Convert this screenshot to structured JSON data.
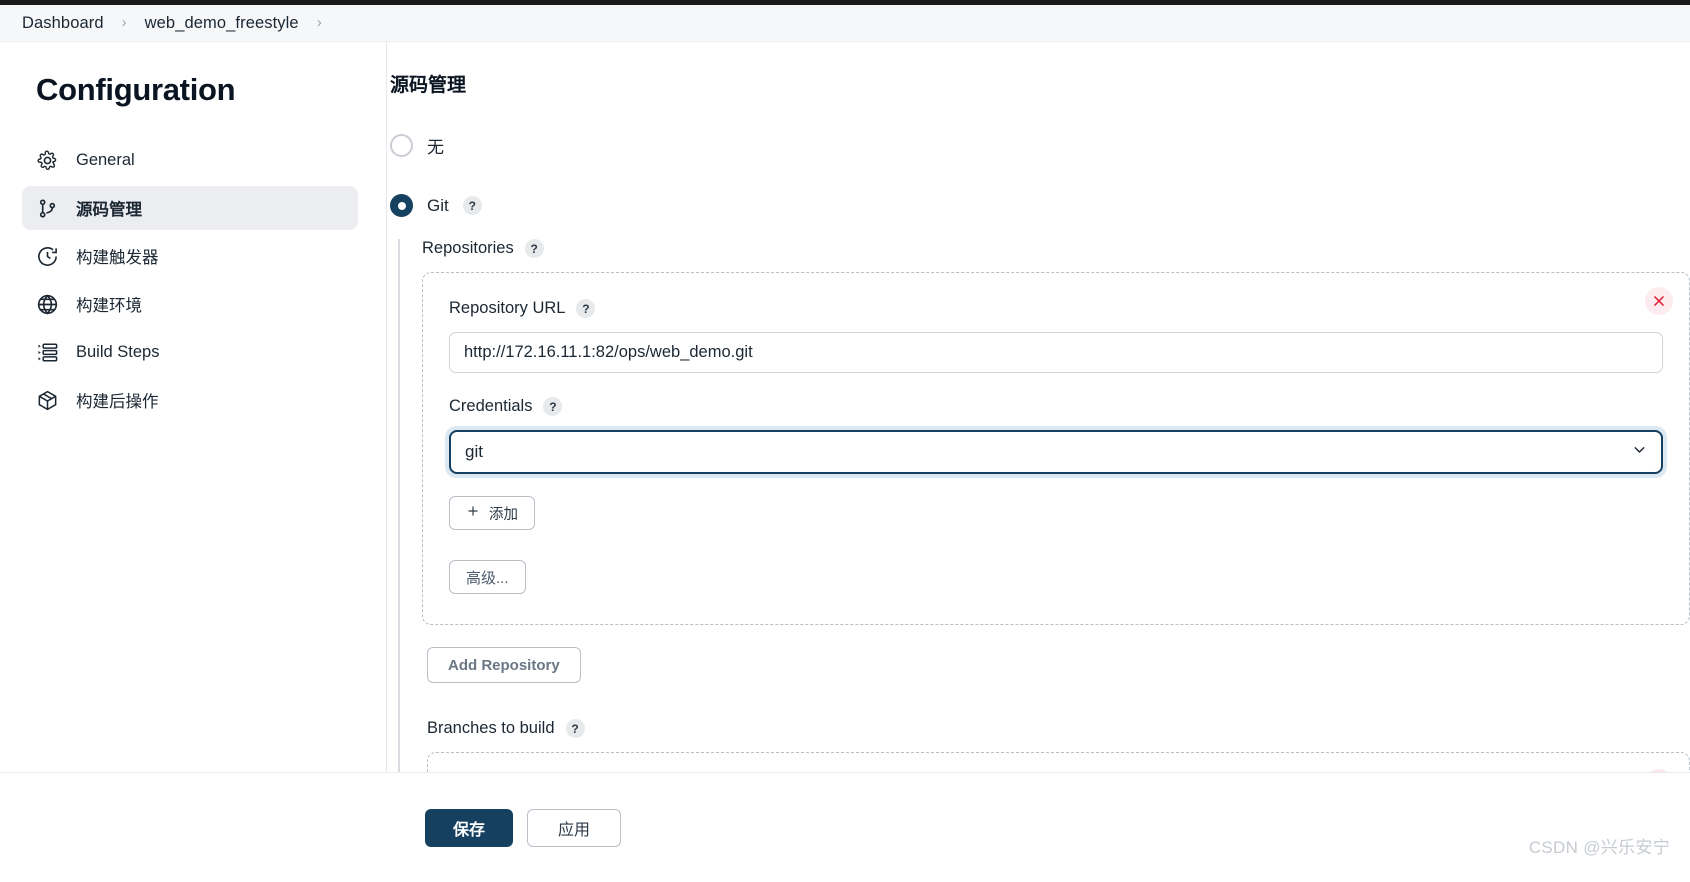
{
  "breadcrumb": {
    "items": [
      {
        "label": "Dashboard"
      },
      {
        "label": "web_demo_freestyle"
      }
    ],
    "separator": "›"
  },
  "sidebar": {
    "title": "Configuration",
    "items": [
      {
        "label": "General",
        "icon": "gear-icon",
        "active": false
      },
      {
        "label": "源码管理",
        "icon": "git-branch-icon",
        "active": true
      },
      {
        "label": "构建触发器",
        "icon": "clock-icon",
        "active": false
      },
      {
        "label": "构建环境",
        "icon": "globe-icon",
        "active": false
      },
      {
        "label": "Build Steps",
        "icon": "list-steps-icon",
        "active": false
      },
      {
        "label": "构建后操作",
        "icon": "package-icon",
        "active": false
      }
    ]
  },
  "main": {
    "section_title": "源码管理",
    "scm_options": [
      {
        "label": "无",
        "selected": false,
        "has_help": false
      },
      {
        "label": "Git",
        "selected": true,
        "has_help": true
      }
    ],
    "repositories_label": "Repositories",
    "repository": {
      "url_label": "Repository URL",
      "url_value": "http://172.16.11.1:82/ops/web_demo.git",
      "credentials_label": "Credentials",
      "credentials_value": "git",
      "add_credentials_label": "添加",
      "add_credentials_icon": "plus-icon",
      "advanced_label": "高级...",
      "delete_icon": "close-icon"
    },
    "add_repository_label": "Add Repository",
    "branches_label": "Branches to build",
    "help_badge": "?"
  },
  "actions": {
    "save_label": "保存",
    "apply_label": "应用"
  },
  "watermark": "CSDN @兴乐安宁",
  "colors": {
    "accent": "#15405f",
    "danger": "#e0233a",
    "sidebar_active_bg": "#ebedf0",
    "breadcrumb_bg": "#f6f7f8"
  }
}
